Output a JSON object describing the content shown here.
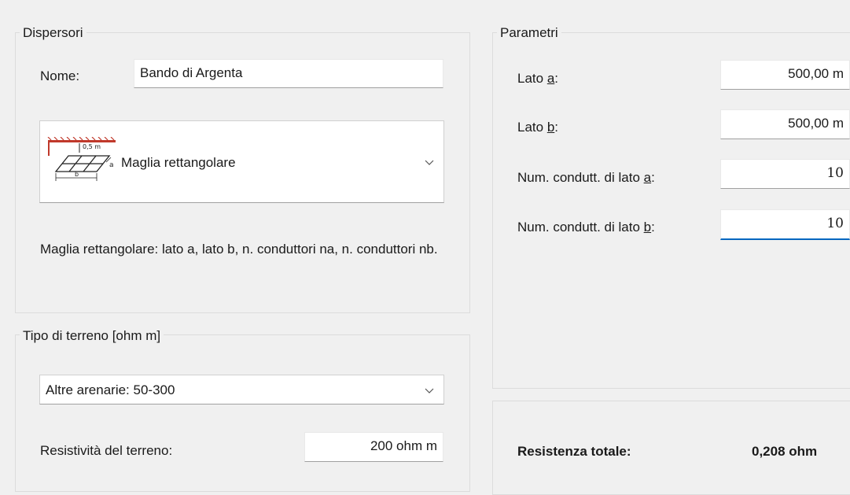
{
  "dispersori": {
    "legend": "Dispersori",
    "name_label": "Nome:",
    "name_value": "Bando di Argenta",
    "type_selected": "Maglia rettangolare",
    "diagram_depth_label": "0,5 m",
    "diagram_a_label": "a",
    "diagram_b_label": "b",
    "description": "Maglia rettangolare: lato a, lato b, n. conduttori na, n. conduttori nb."
  },
  "terreno": {
    "legend": "Tipo di terreno [ohm m]",
    "type_selected": "Altre arenarie: 50-300",
    "resistivity_label": "Resistività del terreno:",
    "resistivity_value": "200 ohm m"
  },
  "parametri": {
    "legend": "Parametri",
    "lato_a_prefix": "Lato ",
    "lato_a_key": "a",
    "lato_a_suffix": ":",
    "lato_a_value": "500,00 m",
    "lato_b_prefix": "Lato ",
    "lato_b_key": "b",
    "lato_b_suffix": ":",
    "lato_b_value": "500,00 m",
    "num_a_prefix": "Num. condutt. di lato ",
    "num_a_key": "a",
    "num_a_suffix": ":",
    "num_a_value": "10",
    "num_b_prefix": "Num. condutt. di lato ",
    "num_b_key": "b",
    "num_b_suffix": ":",
    "num_b_value": "10"
  },
  "result": {
    "label": "Resistenza totale:",
    "value": "0,208 ohm"
  }
}
